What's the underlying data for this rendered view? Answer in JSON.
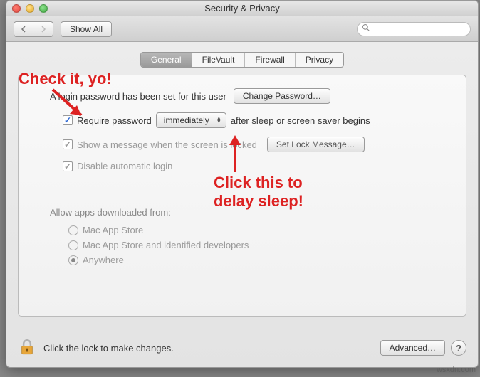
{
  "window": {
    "title": "Security & Privacy"
  },
  "toolbar": {
    "show_all": "Show All",
    "search_placeholder": ""
  },
  "tabs": {
    "general": "General",
    "filevault": "FileVault",
    "firewall": "Firewall",
    "privacy": "Privacy"
  },
  "panel": {
    "password_set_text": "A login password has been set for this user",
    "change_password_btn": "Change Password…",
    "require_password_label": "Require password",
    "delay_selected": "immediately",
    "after_text": "after sleep or screen saver begins",
    "show_message_label": "Show a message when the screen is locked",
    "set_lock_message_btn": "Set Lock Message…",
    "disable_auto_login_label": "Disable automatic login",
    "allow_apps_label": "Allow apps downloaded from:",
    "radio_mas": "Mac App Store",
    "radio_mas_dev": "Mac App Store and identified developers",
    "radio_anywhere": "Anywhere"
  },
  "footer": {
    "lock_text": "Click the lock to make changes.",
    "advanced_btn": "Advanced…"
  },
  "annotations": {
    "check_it": "Check it, yo!",
    "click_this_line1": "Click this to",
    "click_this_line2": "delay sleep!"
  },
  "watermark": "wsxdn.com"
}
